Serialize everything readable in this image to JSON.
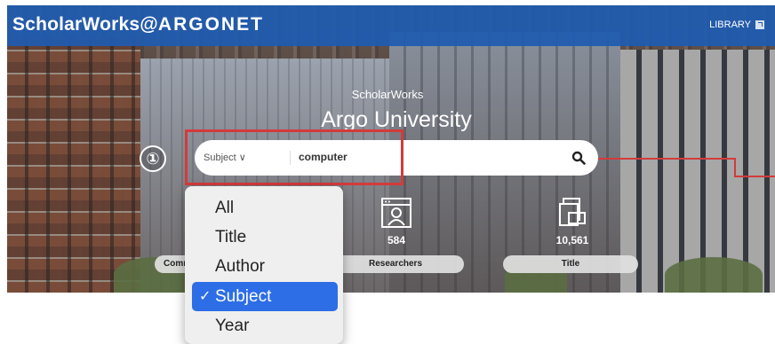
{
  "header": {
    "brand_prefix": "ScholarWorks@",
    "brand_org": "ARGONET",
    "library_link": "LIBRARY"
  },
  "hero": {
    "subtitle": "ScholarWorks",
    "title": "Argo University"
  },
  "search": {
    "field_selector": "Subject",
    "query_value": "computer"
  },
  "annotation": {
    "step_number": "①"
  },
  "stats": [
    {
      "count": "",
      "label": "Comm"
    },
    {
      "count": "584",
      "label": "Researchers"
    },
    {
      "count": "10,561",
      "label": "Title"
    }
  ],
  "dropdown": {
    "options": [
      {
        "label": "All",
        "selected": false
      },
      {
        "label": "Title",
        "selected": false
      },
      {
        "label": "Author",
        "selected": false
      },
      {
        "label": "Subject",
        "selected": true
      },
      {
        "label": "Year",
        "selected": false
      }
    ],
    "check_mark": "✓"
  },
  "colors": {
    "header_bg": "#1f5bb0",
    "annotation_red": "#d33b3b",
    "selected_option": "#2d6ee6"
  },
  "icons": {
    "search": "magnifier-icon",
    "researchers": "researcher-profile-icon",
    "title": "book-stack-icon",
    "library": "external-link-icon"
  }
}
